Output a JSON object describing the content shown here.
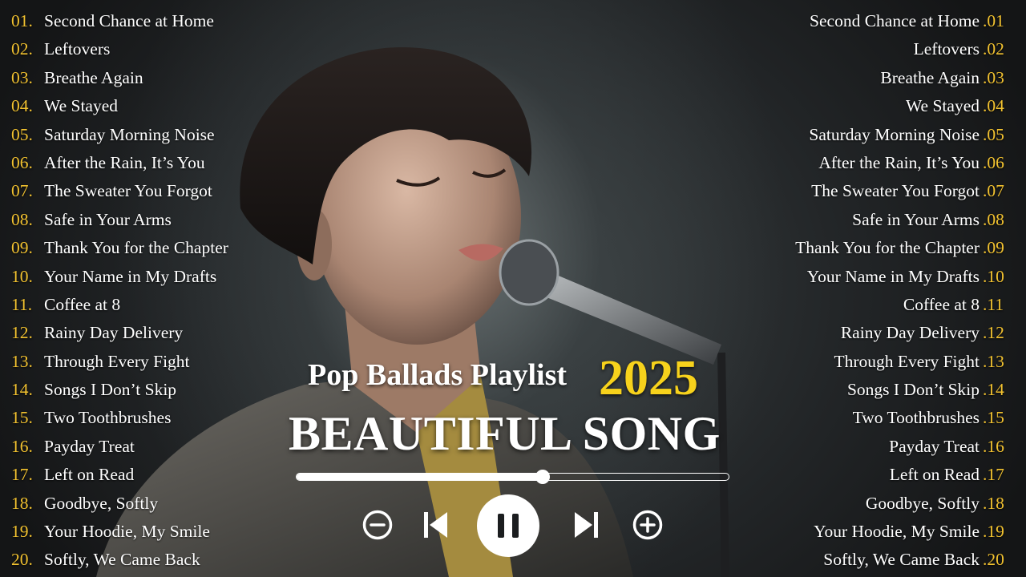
{
  "playlist": {
    "subtitle": "Pop Ballads Playlist",
    "year": "2025",
    "headline": "BEAUTIFUL SONG"
  },
  "tracks": [
    {
      "n": "01",
      "title": "Second Chance at Home"
    },
    {
      "n": "02",
      "title": "Leftovers"
    },
    {
      "n": "03",
      "title": "Breathe Again"
    },
    {
      "n": "04",
      "title": "We Stayed"
    },
    {
      "n": "05",
      "title": "Saturday Morning Noise"
    },
    {
      "n": "06",
      "title": "After the Rain, It’s You"
    },
    {
      "n": "07",
      "title": "The Sweater You Forgot"
    },
    {
      "n": "08",
      "title": "Safe in Your Arms"
    },
    {
      "n": "09",
      "title": "Thank You for the Chapter"
    },
    {
      "n": "10",
      "title": "Your Name in My Drafts"
    },
    {
      "n": "11",
      "title": "Coffee at 8"
    },
    {
      "n": "12",
      "title": "Rainy Day Delivery"
    },
    {
      "n": "13",
      "title": "Through Every Fight"
    },
    {
      "n": "14",
      "title": "Songs I Don’t Skip"
    },
    {
      "n": "15",
      "title": "Two Toothbrushes"
    },
    {
      "n": "16",
      "title": "Payday Treat"
    },
    {
      "n": "17",
      "title": "Left on Read"
    },
    {
      "n": "18",
      "title": "Goodbye, Softly"
    },
    {
      "n": "19",
      "title": "Your Hoodie, My Smile"
    },
    {
      "n": "20",
      "title": "Softly, We Came Back"
    }
  ],
  "player": {
    "progress": 0.57,
    "controls": [
      "minus-circle-icon",
      "skip-previous-icon",
      "pause-icon",
      "skip-next-icon",
      "plus-circle-icon"
    ]
  },
  "colors": {
    "number_accent": "#f2c230",
    "year_accent": "#f7d21c",
    "text": "#ffffff"
  }
}
